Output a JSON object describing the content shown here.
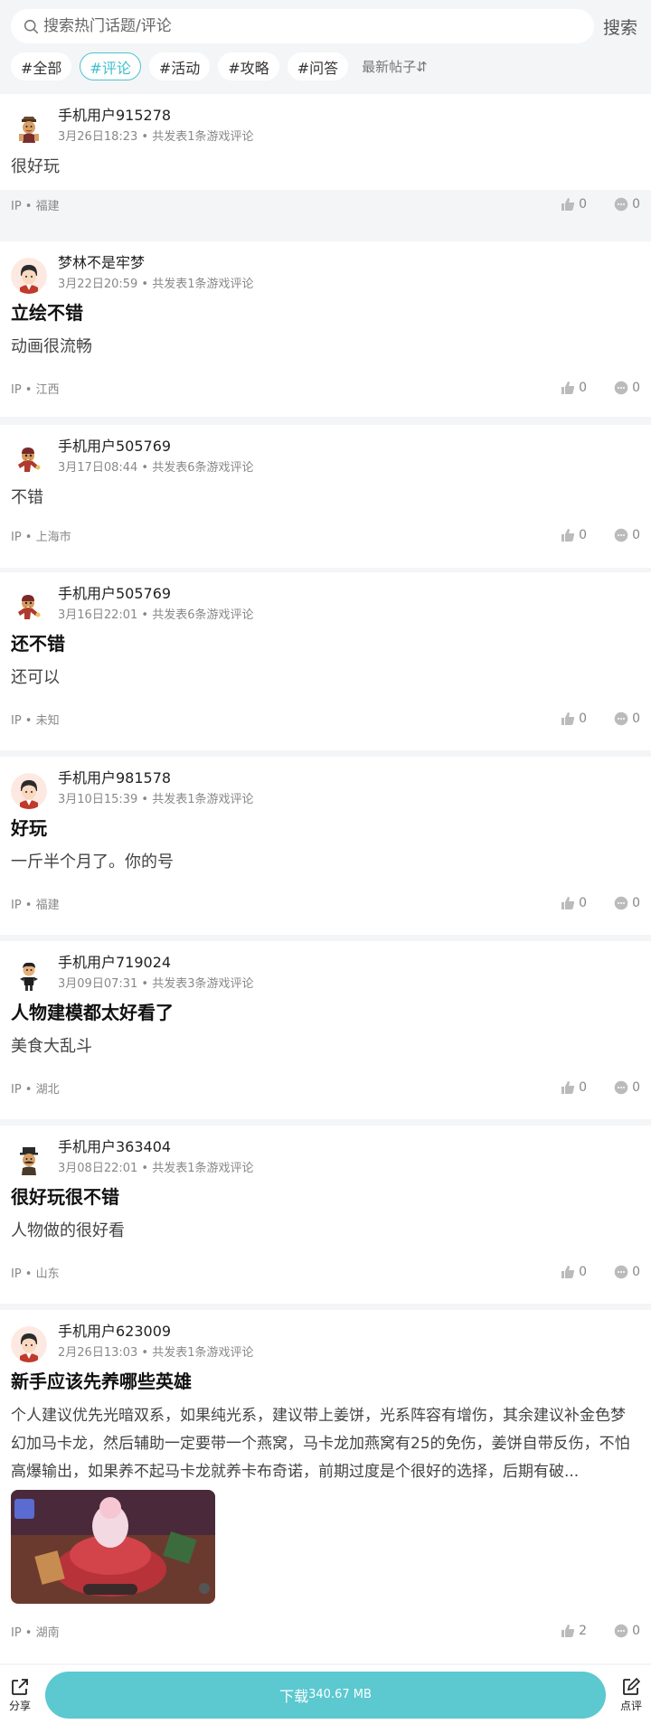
{
  "search": {
    "placeholder": "搜索热门话题/评论",
    "button_label": "搜索"
  },
  "tags": [
    {
      "label": "#全部",
      "active": false
    },
    {
      "label": "#评论",
      "active": true
    },
    {
      "label": "#活动",
      "active": false
    },
    {
      "label": "#攻略",
      "active": false
    },
    {
      "label": "#问答",
      "active": false
    }
  ],
  "sort_label": "最新帖子⇵",
  "posts": [
    {
      "user": "手机用户915278",
      "meta": "3月26日18:23 • 共发表1条游戏评论",
      "title": "",
      "body": "很好玩",
      "ip": "IP • 福建",
      "likes": "0",
      "comments": "0"
    },
    {
      "user": "梦林不是牢梦",
      "meta": "3月22日20:59 • 共发表1条游戏评论",
      "title": "立绘不错",
      "body": "动画很流畅",
      "ip": "IP • 江西",
      "likes": "0",
      "comments": "0"
    },
    {
      "user": "手机用户505769",
      "meta": "3月17日08:44 • 共发表6条游戏评论",
      "title": "",
      "body": "不错",
      "ip": "IP • 上海市",
      "likes": "0",
      "comments": "0"
    },
    {
      "user": "手机用户505769",
      "meta": "3月16日22:01 • 共发表6条游戏评论",
      "title": "还不错",
      "body": "还可以",
      "ip": "IP • 未知",
      "likes": "0",
      "comments": "0"
    },
    {
      "user": "手机用户981578",
      "meta": "3月10日15:39 • 共发表1条游戏评论",
      "title": "好玩",
      "body": "一斤半个月了。你的号",
      "ip": "IP • 福建",
      "likes": "0",
      "comments": "0"
    },
    {
      "user": "手机用户719024",
      "meta": "3月09日07:31 • 共发表3条游戏评论",
      "title": "人物建模都太好看了",
      "body": "美食大乱斗",
      "ip": "IP • 湖北",
      "likes": "0",
      "comments": "0"
    },
    {
      "user": "手机用户363404",
      "meta": "3月08日22:01 • 共发表1条游戏评论",
      "title": "很好玩很不错",
      "body": "人物做的很好看",
      "ip": "IP • 山东",
      "likes": "0",
      "comments": "0"
    },
    {
      "user": "手机用户623009",
      "meta": "2月26日13:03 • 共发表1条游戏评论",
      "title": "新手应该先养哪些英雄",
      "body": "个人建议优先光暗双系，如果纯光系，建议带上姜饼，光系阵容有增伤，其余建议补金色梦幻加马卡龙，然后辅助一定要带一个燕窝，马卡龙加燕窝有25的免伤，姜饼自带反伤，不怕高爆输出，如果养不起马卡龙就养卡布奇诺，前期过度是个很好的选择，后期有破...",
      "ip": "IP • 湖南",
      "likes": "2",
      "comments": "0"
    }
  ],
  "bottom": {
    "share_label": "分享",
    "download_label": "下载",
    "download_size": "340.67 MB",
    "review_label": "点评"
  },
  "colors": {
    "accent": "#5cc8d0",
    "tag_active": "#3fbfcc"
  }
}
